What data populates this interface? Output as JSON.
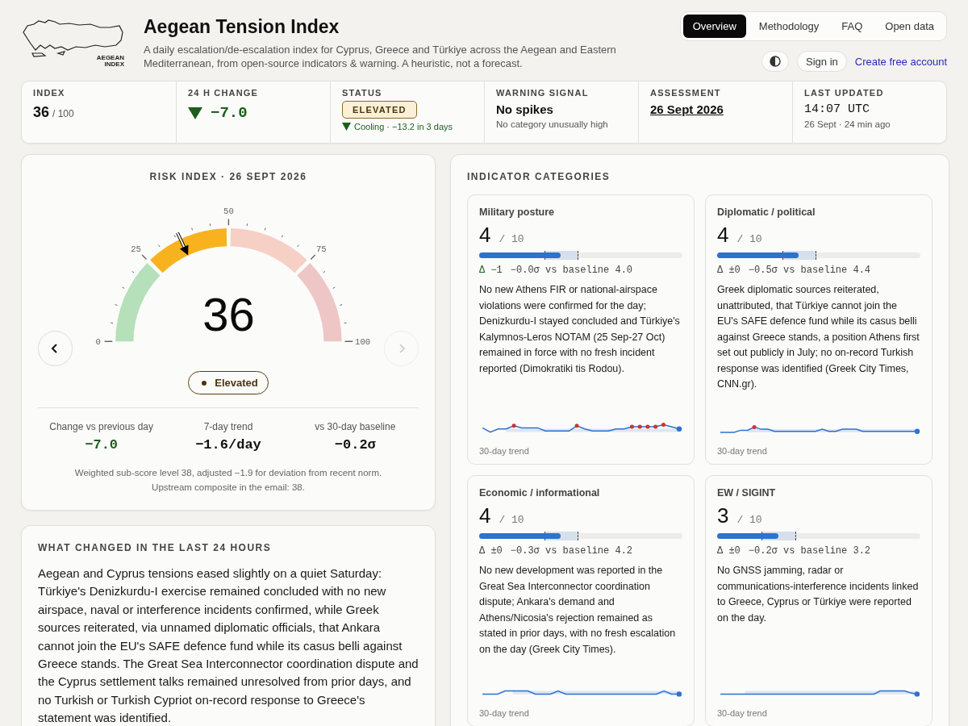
{
  "header": {
    "logo_text": [
      "AEGEAN",
      "INDEX"
    ],
    "title": "Aegean Tension Index",
    "subtitle": "A daily escalation/de-escalation index for Cyprus, Greece and Türkiye across the Aegean and Eastern Mediterranean, from open-source indicators & warning. A heuristic, not a forecast.",
    "tabs": [
      {
        "label": "Overview",
        "selected": true
      },
      {
        "label": "Methodology",
        "selected": false
      },
      {
        "label": "FAQ",
        "selected": false
      },
      {
        "label": "Open data",
        "selected": false
      }
    ],
    "sign_in": "Sign in",
    "create_account": "Create free account"
  },
  "stats": [
    {
      "kind": "index",
      "label": "INDEX",
      "value": "36",
      "suffix": "/ 100"
    },
    {
      "kind": "change",
      "label": "24 H CHANGE",
      "value": "−7.0",
      "falling": true
    },
    {
      "kind": "status",
      "label": "STATUS",
      "value": "ELEVATED",
      "note": "Cooling · −13.2 in 3 days",
      "falling": true
    },
    {
      "kind": "text",
      "label": "WARNING SIGNAL",
      "value": "No spikes",
      "note": "No category unusually high"
    },
    {
      "kind": "date",
      "label": "ASSESSMENT",
      "value": "26 Sept 2026"
    },
    {
      "kind": "time",
      "label": "LAST UPDATED",
      "value": "14:07 UTC",
      "note": "26 Sept · 24 min ago"
    }
  ],
  "gauge": {
    "title": "RISK INDEX · 26 SEPT 2026",
    "value": "36",
    "level": 0.36,
    "ticks": [
      "0",
      "25",
      "50",
      "75",
      "100"
    ],
    "prev_disabled": false,
    "next_disabled": true,
    "badge": "Elevated",
    "metrics": [
      {
        "label": "Change vs previous day",
        "value": "−7.0",
        "kind": "down"
      },
      {
        "label": "7-day trend",
        "value": "−1.6/day",
        "kind": "flat"
      },
      {
        "label": "vs 30-day baseline",
        "value": "−0.2σ",
        "kind": "flat"
      }
    ],
    "footnote": [
      "Weighted sub-score level 38, adjusted −1.9 for deviation from recent norm.",
      "Upstream composite in the email: 38."
    ]
  },
  "changes": {
    "title": "WHAT CHANGED IN THE LAST 24 HOURS",
    "text": "Aegean and Cyprus tensions eased slightly on a quiet Saturday: Türkiye's Denizkurdu-I exercise remained concluded with no new airspace, naval or interference incidents confirmed, while Greek sources reiterated, via unnamed diplomatic officials, that Ankara cannot join the EU's SAFE defence fund while its casus belli against Greece stands. The Great Sea Interconnector coordination dispute and the Cyprus settlement talks remained unresolved from prior days, and no Turkish or Turkish Cypriot on-record response to Greece's statement was identified."
  },
  "categories": {
    "title": "INDICATOR CATEGORIES",
    "items": [
      {
        "name": "Military posture",
        "score": "4",
        "max": "/ 10",
        "level": 0.4,
        "delta": "Δ −1",
        "delta_falling": true,
        "baseline": "−0.0σ vs baseline 4.0",
        "text": "No new Athens FIR or national-airspace violations were confirmed for the day; Denizkurdu-I stayed concluded and Türkiye's Kalymnos-Leros NOTAM (25 Sep-27 Oct) remained in force with no fresh incident reported (Dimokratiki tis Rodou).",
        "trend_label": "30-day trend"
      },
      {
        "name": "Diplomatic / political",
        "score": "4",
        "max": "/ 10",
        "level": 0.4,
        "delta": "Δ ±0",
        "delta_falling": false,
        "baseline": "−0.5σ vs baseline 4.4",
        "text": "Greek diplomatic sources reiterated, unattributed, that Türkiye cannot join the EU's SAFE defence fund while its casus belli against Greece stands, a position Athens first set out publicly in July; no on-record Turkish response was identified (Greek City Times, CNN.gr).",
        "trend_label": "30-day trend"
      },
      {
        "name": "Economic / informational",
        "score": "4",
        "max": "/ 10",
        "level": 0.4,
        "delta": "Δ ±0",
        "delta_falling": false,
        "baseline": "−0.3σ vs baseline 4.2",
        "text": "No new development was reported in the Great Sea Interconnector coordination dispute; Ankara's demand and Athens/Nicosia's rejection remained as stated in prior days, with no fresh escalation on the day (Greek City Times).",
        "trend_label": "30-day trend"
      },
      {
        "name": "EW / SIGINT",
        "score": "3",
        "max": "/ 10",
        "level": 0.3,
        "delta": "Δ ±0",
        "delta_falling": false,
        "baseline": "−0.2σ vs baseline 3.2",
        "text": "No GNSS jamming, radar or communications-interference incidents linked to Greece, Cyprus or Türkiye were reported on the day.",
        "trend_label": "30-day trend"
      }
    ]
  }
}
